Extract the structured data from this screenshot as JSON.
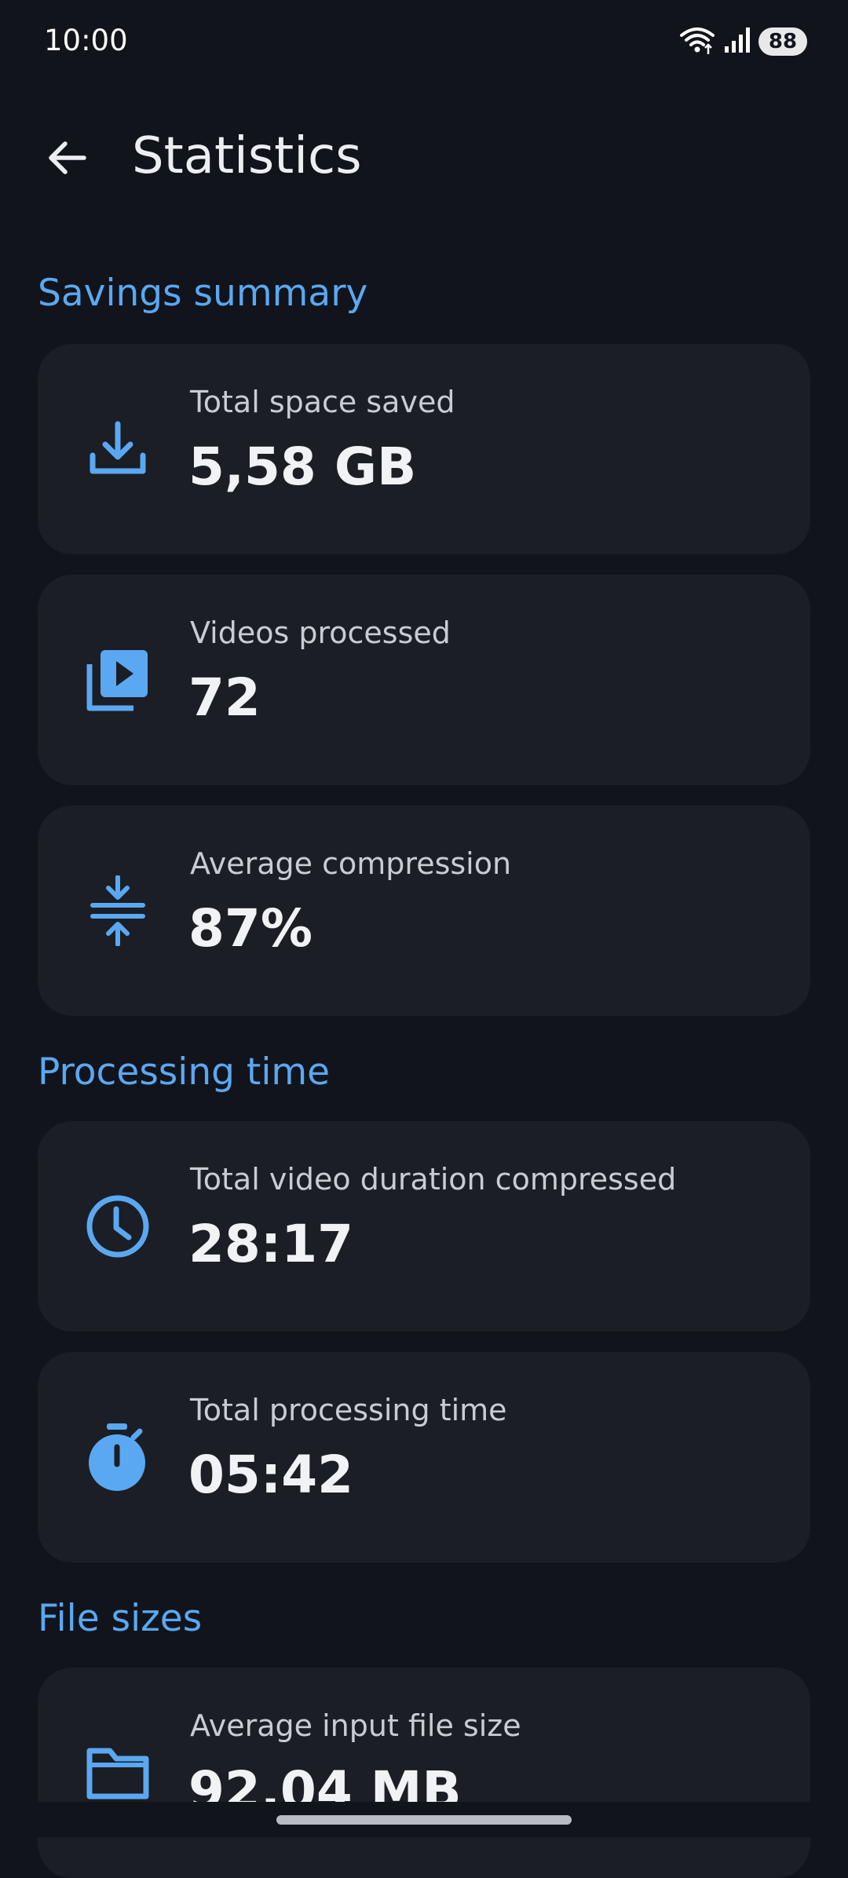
{
  "status_bar": {
    "time": "10:00",
    "battery": "88"
  },
  "app_bar": {
    "title": "Statistics"
  },
  "sections": {
    "savings": {
      "title": "Savings summary",
      "cards": [
        {
          "label": "Total space saved",
          "value": "5,58 GB",
          "icon": "download-icon"
        },
        {
          "label": "Videos processed",
          "value": "72",
          "icon": "video-library-icon"
        },
        {
          "label": "Average compression",
          "value": "87%",
          "icon": "compress-icon"
        }
      ]
    },
    "processing": {
      "title": "Processing time",
      "cards": [
        {
          "label": "Total video duration compressed",
          "value": "28:17",
          "icon": "clock-icon"
        },
        {
          "label": "Total processing time",
          "value": "05:42",
          "icon": "stopwatch-icon"
        }
      ]
    },
    "file_sizes": {
      "title": "File sizes",
      "cards": [
        {
          "label": "Average input file size",
          "value": "92,04 MB",
          "icon": "folder-icon"
        }
      ]
    }
  },
  "colors": {
    "background": "#11141b",
    "card": "#1b1e24",
    "accent": "#5aa8f2"
  }
}
